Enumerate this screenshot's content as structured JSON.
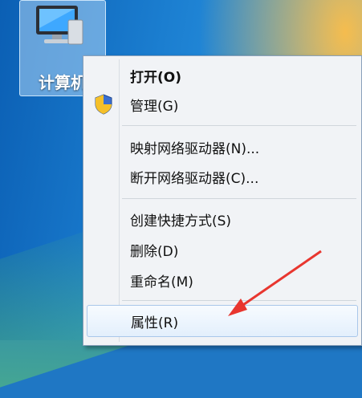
{
  "desktop": {
    "icon": {
      "name": "computer-icon",
      "label": "计算机"
    }
  },
  "context_menu": {
    "items": [
      {
        "label": "打开(O)",
        "bold": true,
        "icon": null
      },
      {
        "label": "管理(G)",
        "bold": false,
        "icon": "uac-shield-icon"
      },
      {
        "label": "映射网络驱动器(N)...",
        "bold": false,
        "icon": null
      },
      {
        "label": "断开网络驱动器(C)...",
        "bold": false,
        "icon": null
      },
      {
        "label": "创建快捷方式(S)",
        "bold": false,
        "icon": null
      },
      {
        "label": "删除(D)",
        "bold": false,
        "icon": null
      },
      {
        "label": "重命名(M)",
        "bold": false,
        "icon": null
      },
      {
        "label": "属性(R)",
        "bold": false,
        "icon": null,
        "highlighted": true
      }
    ]
  },
  "annotation": {
    "arrow_color": "#e8362f"
  }
}
